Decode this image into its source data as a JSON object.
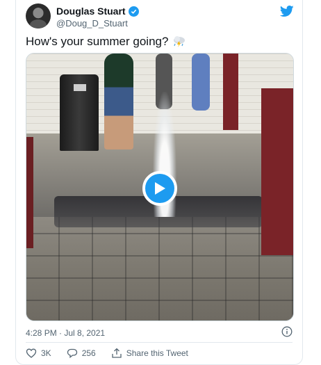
{
  "author": {
    "display_name": "Douglas Stuart",
    "handle": "@Doug_D_Stuart",
    "verified": true
  },
  "tweet": {
    "text": "How's your summer going?",
    "emoji": "cloud-with-lightning-and-rain"
  },
  "media": {
    "type": "video",
    "play_icon": "play-icon"
  },
  "meta": {
    "timestamp": "4:28 PM · Jul 8, 2021"
  },
  "actions": {
    "likes": "3K",
    "replies": "256",
    "share_label": "Share this Tweet"
  },
  "colors": {
    "accent": "#1d9bf0",
    "text_primary": "#0f1419",
    "text_secondary": "#536471",
    "border": "#e1e8ed"
  }
}
